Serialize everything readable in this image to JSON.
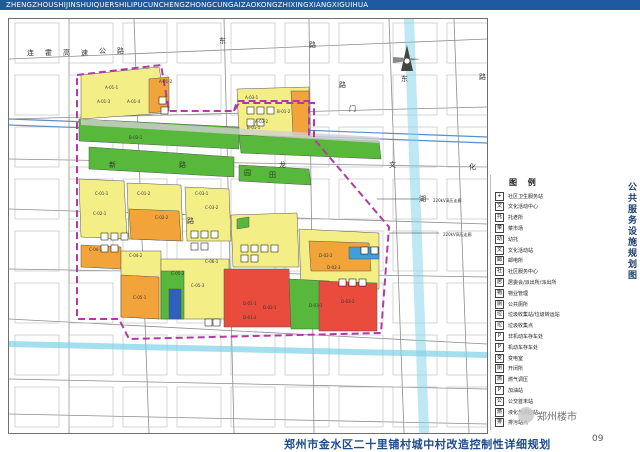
{
  "header": {
    "pinyin_strip": "ZHENGZHOUSHIJINSHUIQUERSHILIPUCUNCHENGZHONGCUNGAIZAOKONGZHIXINGXIANGXIGUIHUA"
  },
  "title": {
    "main": "郑州市金水区二十里铺村城中村改造控制性详细规划",
    "vertical": "公共服务设施规划图"
  },
  "watermark": {
    "text": "郑州楼市",
    "page": "09"
  },
  "map": {
    "road_labels": [
      "连",
      "霍",
      "高",
      "速",
      "公",
      "路",
      "东",
      "路",
      "东",
      "门",
      "新",
      "路",
      "龙",
      "湖",
      "路",
      "园",
      "田",
      "路",
      "路",
      "文",
      "化"
    ],
    "block_labels": [
      "A-01-1",
      "A-01-2",
      "A-01-3",
      "A-01-4",
      "A-03-1",
      "A-03-2",
      "B-01-1",
      "B-01-2",
      "B-02-1",
      "C-01-1",
      "C-01-2",
      "C-02-1",
      "C-02-2",
      "C-03-1",
      "C-03-2",
      "C-04-1",
      "C-04-2",
      "C-05-1",
      "C-05-2",
      "C-05-3",
      "C-06-1",
      "D-01-1",
      "D-01-2",
      "D-02-1",
      "D-02-2",
      "D-02-3",
      "D-03-1",
      "D-03-2"
    ],
    "callouts": [
      "220kV高压走廊",
      "220kV高压走廊"
    ],
    "colors": {
      "residential": "#f4ee86",
      "commercial": "#e94b3c",
      "green": "#57b83b",
      "mixed": "#f2a43a",
      "public": "#c77f3c",
      "water": "#7dd2e8",
      "boundary": "#b33aa6"
    }
  },
  "legend": {
    "title": "图 例",
    "items": [
      {
        "sym": "+",
        "label": "社区卫生服务站"
      },
      {
        "sym": "文",
        "label": "文化活动中心"
      },
      {
        "sym": "托",
        "label": "托老所"
      },
      {
        "sym": "菜",
        "label": "菜市场"
      },
      {
        "sym": "幼",
        "label": "幼托"
      },
      {
        "sym": "文",
        "label": "文化活动站"
      },
      {
        "sym": "邮",
        "label": "邮电所"
      },
      {
        "sym": "社",
        "label": "社区服务中心"
      },
      {
        "sym": "居",
        "label": "居委会/派出所/派出所"
      },
      {
        "sym": "物",
        "label": "物业管理"
      },
      {
        "sym": "厕",
        "label": "公共厕所"
      },
      {
        "sym": "垃",
        "label": "垃圾收集站/垃圾转运站"
      },
      {
        "sym": "垃",
        "label": "垃圾收集点"
      },
      {
        "sym": "P",
        "label": "非机动车存车处"
      },
      {
        "sym": "P",
        "label": "机动车存车处"
      },
      {
        "sym": "变",
        "label": "变电室"
      },
      {
        "sym": "厕",
        "label": "开闭所"
      },
      {
        "sym": "燃",
        "label": "燃气调压"
      },
      {
        "sym": "P",
        "label": "加油站"
      },
      {
        "sym": "公",
        "label": "公交首末站"
      },
      {
        "sym": "燃",
        "label": "液化气供应站"
      },
      {
        "sym": "排",
        "label": "排污站点"
      }
    ]
  }
}
